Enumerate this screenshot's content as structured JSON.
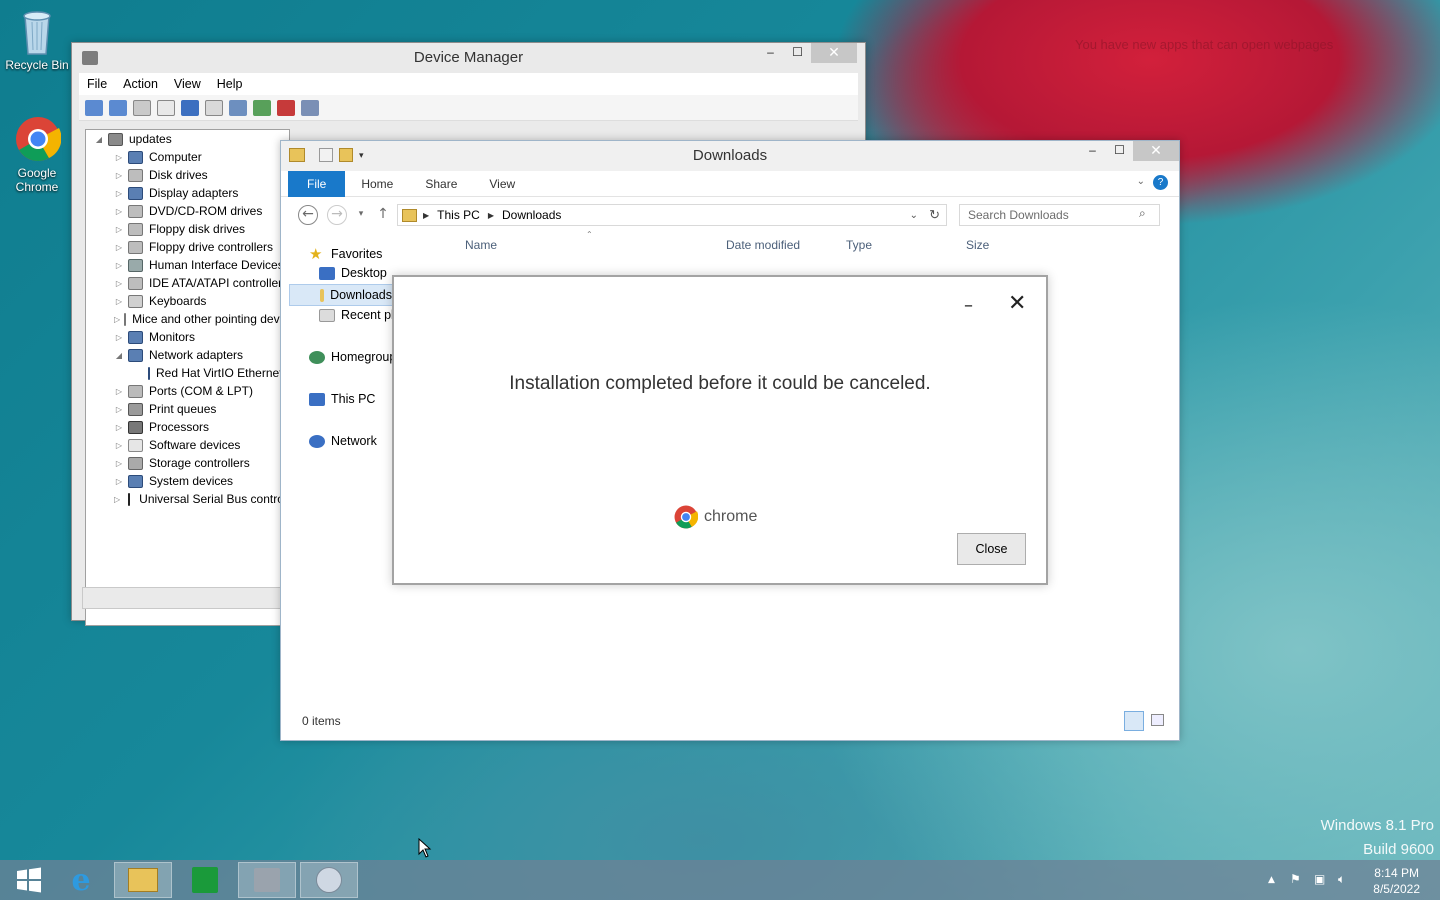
{
  "desktop": {
    "icons": [
      {
        "label": "Recycle Bin",
        "icon": "recycle-bin-icon"
      },
      {
        "label": "Google Chrome",
        "icon": "chrome-icon"
      }
    ],
    "notification": "You have new apps that can open webpages",
    "watermark": {
      "line1": "Windows 8.1 Pro",
      "line2": "Build 9600"
    }
  },
  "device_manager": {
    "title": "Device Manager",
    "menu": [
      "File",
      "Action",
      "View",
      "Help"
    ],
    "tree_root": "updates",
    "tree_items": [
      "Computer",
      "Disk drives",
      "Display adapters",
      "DVD/CD-ROM drives",
      "Floppy disk drives",
      "Floppy drive controllers",
      "Human Interface Devices",
      "IDE ATA/ATAPI controllers",
      "Keyboards",
      "Mice and other pointing devices",
      "Monitors",
      "Network adapters",
      "Red Hat VirtIO Ethernet Adapter",
      "Ports (COM & LPT)",
      "Print queues",
      "Processors",
      "Software devices",
      "Storage controllers",
      "System devices",
      "Universal Serial Bus controllers"
    ]
  },
  "explorer": {
    "title": "Downloads",
    "ribbon_tabs": [
      "File",
      "Home",
      "Share",
      "View"
    ],
    "breadcrumb": [
      "This PC",
      "Downloads"
    ],
    "search_placeholder": "Search Downloads",
    "nav": {
      "favorites": "Favorites",
      "desktop": "Desktop",
      "downloads": "Downloads",
      "recent": "Recent places",
      "homegroup": "Homegroup",
      "this_pc": "This PC",
      "network": "Network"
    },
    "columns": [
      "Name",
      "Date modified",
      "Type",
      "Size"
    ],
    "status": "0 items"
  },
  "dialog": {
    "message": "Installation completed before it could be canceled.",
    "brand": "chrome",
    "close_button": "Close",
    "minimize_glyph": "–",
    "close_glyph": "✕"
  },
  "taskbar": {
    "time": "8:14 PM",
    "date": "8/5/2022"
  },
  "colors": {
    "ribbon_file": "#1979ca",
    "chrome_red": "#db4437",
    "chrome_green": "#0f9d58",
    "chrome_yellow": "#f4b400",
    "chrome_blue": "#4285f4"
  }
}
